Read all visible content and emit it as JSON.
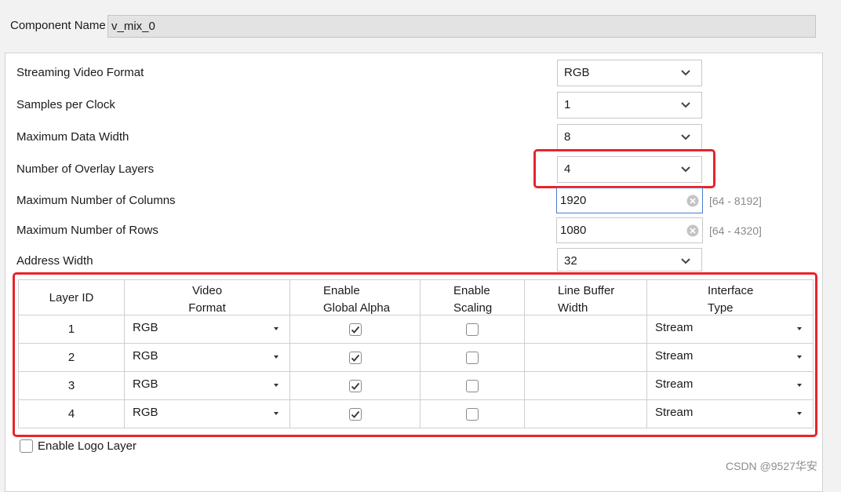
{
  "component": {
    "label": "Component Name",
    "value": "v_mix_0"
  },
  "fields": {
    "streaming_video_format": {
      "label": "Streaming Video Format",
      "value": "RGB"
    },
    "samples_per_clock": {
      "label": "Samples per Clock",
      "value": "1"
    },
    "maximum_data_width": {
      "label": "Maximum Data Width",
      "value": "8"
    },
    "number_of_overlay_layers": {
      "label": "Number of Overlay Layers",
      "value": "4"
    },
    "maximum_number_of_columns": {
      "label": "Maximum Number of Columns",
      "value": "1920",
      "range": "[64 - 8192]"
    },
    "maximum_number_of_rows": {
      "label": "Maximum Number of Rows",
      "value": "1080",
      "range": "[64 - 4320]"
    },
    "address_width": {
      "label": "Address Width",
      "value": "32"
    }
  },
  "table": {
    "headers": {
      "layer_id": "Layer ID",
      "video_format": [
        "Video",
        "Format"
      ],
      "global_alpha": [
        "Enable",
        "Global Alpha"
      ],
      "scaling": [
        "Enable",
        "Scaling"
      ],
      "line_buffer": [
        "Line Buffer",
        "Width"
      ],
      "interface_type": [
        "Interface",
        "Type"
      ]
    },
    "rows": [
      {
        "id": "1",
        "video_format": "RGB",
        "global_alpha": true,
        "scaling": false,
        "line_buffer": "",
        "interface_type": "Stream"
      },
      {
        "id": "2",
        "video_format": "RGB",
        "global_alpha": true,
        "scaling": false,
        "line_buffer": "",
        "interface_type": "Stream"
      },
      {
        "id": "3",
        "video_format": "RGB",
        "global_alpha": true,
        "scaling": false,
        "line_buffer": "",
        "interface_type": "Stream"
      },
      {
        "id": "4",
        "video_format": "RGB",
        "global_alpha": true,
        "scaling": false,
        "line_buffer": "",
        "interface_type": "Stream"
      }
    ]
  },
  "logo_layer": {
    "label": "Enable Logo Layer",
    "checked": false
  },
  "watermark": "CSDN @9527华安",
  "colors": {
    "highlight": "#e8242b",
    "focus_border": "#4a7bd0"
  }
}
